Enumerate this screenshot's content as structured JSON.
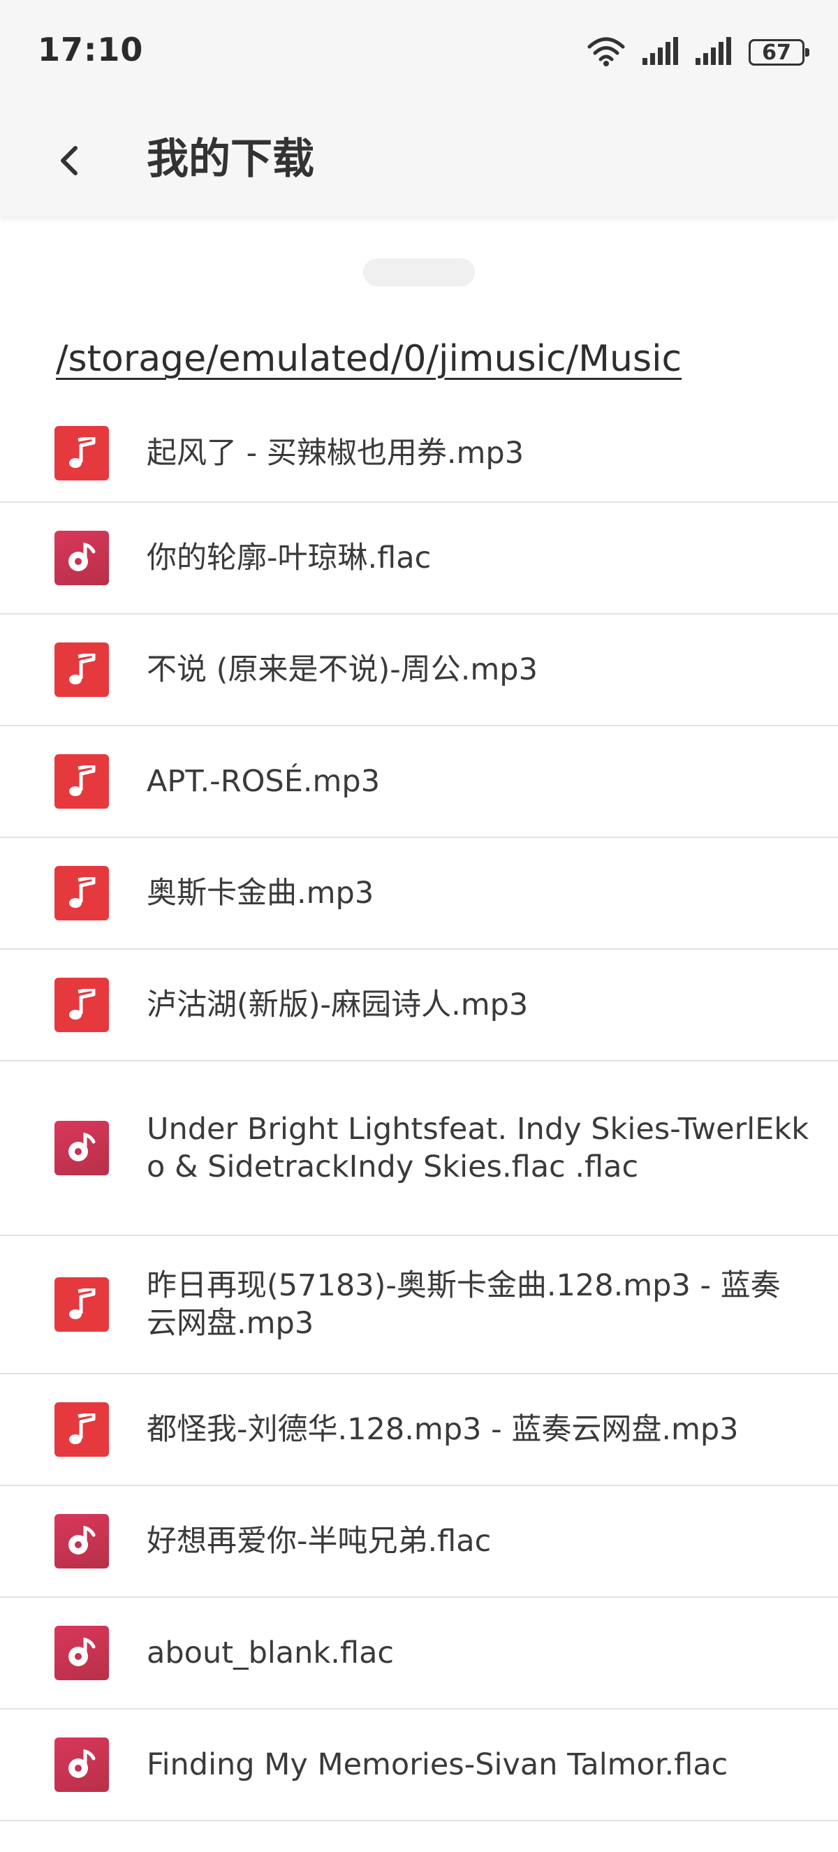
{
  "status_bar": {
    "time": "17:10",
    "battery": "67",
    "icons": [
      "wifi-icon",
      "signal-icon",
      "signal-icon"
    ]
  },
  "header": {
    "back_icon": "chevron-left-icon",
    "title": "我的下载"
  },
  "path": "/storage/emulated/0/jimusic/Music",
  "colors": {
    "mp3_icon": "#e6393e",
    "flac_icon": "#c8334f",
    "divider": "#e3e3e3"
  },
  "files": [
    {
      "name": "起风了 - 买辣椒也用券.mp3",
      "type": "mp3"
    },
    {
      "name": "你的轮廓-叶琼琳.flac",
      "type": "flac"
    },
    {
      "name": "不说 (原来是不说)-周公.mp3",
      "type": "mp3"
    },
    {
      "name": "APT.-ROSÉ.mp3",
      "type": "mp3"
    },
    {
      "name": "奥斯卡金曲.mp3",
      "type": "mp3"
    },
    {
      "name": "泸沽湖(新版)-麻园诗人.mp3",
      "type": "mp3"
    },
    {
      "name": "Under Bright Lightsfeat. Indy Skies-TwerlEkko & SidetrackIndy Skies.flac .flac",
      "type": "flac"
    },
    {
      "name": "昨日再现(57183)-奥斯卡金曲.128.mp3 - 蓝奏云网盘.mp3",
      "type": "mp3"
    },
    {
      "name": "都怪我-刘德华.128.mp3 - 蓝奏云网盘.mp3",
      "type": "mp3"
    },
    {
      "name": "好想再爱你-半吨兄弟.flac",
      "type": "flac"
    },
    {
      "name": "about_blank.flac",
      "type": "flac"
    },
    {
      "name": "Finding My Memories-Sivan Talmor.flac",
      "type": "flac"
    }
  ]
}
